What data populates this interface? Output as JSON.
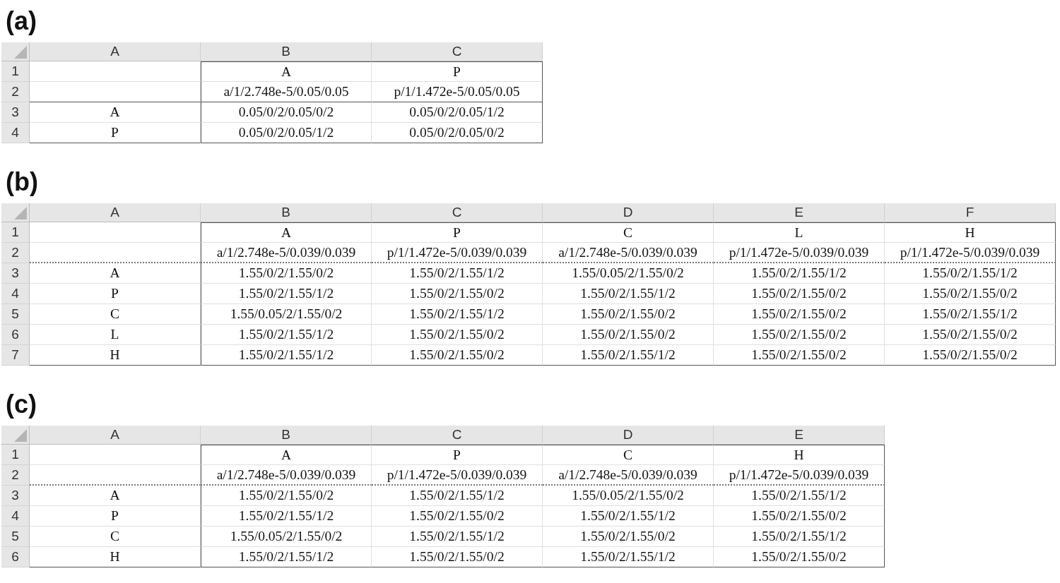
{
  "panels": [
    {
      "label": "(a)",
      "dotted_separator": false,
      "columns": [
        "A",
        "B",
        "C"
      ],
      "rows": [
        {
          "number": "1",
          "cells": [
            "",
            "A",
            "P"
          ]
        },
        {
          "number": "2",
          "cells": [
            "",
            "a/1/2.748e-5/0.05/0.05",
            "p/1/1.472e-5/0.05/0.05"
          ]
        },
        {
          "number": "3",
          "cells": [
            "A",
            "0.05/0/2/0.05/0/2",
            "0.05/0/2/0.05/1/2"
          ]
        },
        {
          "number": "4",
          "cells": [
            "P",
            "0.05/0/2/0.05/1/2",
            "0.05/0/2/0.05/0/2"
          ]
        }
      ]
    },
    {
      "label": "(b)",
      "dotted_separator": true,
      "columns": [
        "A",
        "B",
        "C",
        "D",
        "E",
        "F"
      ],
      "rows": [
        {
          "number": "1",
          "cells": [
            "",
            "A",
            "P",
            "C",
            "L",
            "H"
          ]
        },
        {
          "number": "2",
          "cells": [
            "",
            "a/1/2.748e-5/0.039/0.039",
            "p/1/1.472e-5/0.039/0.039",
            "a/1/2.748e-5/0.039/0.039",
            "p/1/1.472e-5/0.039/0.039",
            "p/1/1.472e-5/0.039/0.039"
          ]
        },
        {
          "number": "3",
          "cells": [
            "A",
            "1.55/0/2/1.55/0/2",
            "1.55/0/2/1.55/1/2",
            "1.55/0.05/2/1.55/0/2",
            "1.55/0/2/1.55/1/2",
            "1.55/0/2/1.55/1/2"
          ]
        },
        {
          "number": "4",
          "cells": [
            "P",
            "1.55/0/2/1.55/1/2",
            "1.55/0/2/1.55/0/2",
            "1.55/0/2/1.55/1/2",
            "1.55/0/2/1.55/0/2",
            "1.55/0/2/1.55/0/2"
          ]
        },
        {
          "number": "5",
          "cells": [
            "C",
            "1.55/0.05/2/1.55/0/2",
            "1.55/0/2/1.55/1/2",
            "1.55/0/2/1.55/0/2",
            "1.55/0/2/1.55/0/2",
            "1.55/0/2/1.55/1/2"
          ]
        },
        {
          "number": "6",
          "cells": [
            "L",
            "1.55/0/2/1.55/1/2",
            "1.55/0/2/1.55/0/2",
            "1.55/0/2/1.55/0/2",
            "1.55/0/2/1.55/0/2",
            "1.55/0/2/1.55/0/2"
          ]
        },
        {
          "number": "7",
          "cells": [
            "H",
            "1.55/0/2/1.55/1/2",
            "1.55/0/2/1.55/0/2",
            "1.55/0/2/1.55/1/2",
            "1.55/0/2/1.55/0/2",
            "1.55/0/2/1.55/0/2"
          ]
        }
      ]
    },
    {
      "label": "(c)",
      "dotted_separator": true,
      "columns": [
        "A",
        "B",
        "C",
        "D",
        "E"
      ],
      "rows": [
        {
          "number": "1",
          "cells": [
            "",
            "A",
            "P",
            "C",
            "H"
          ]
        },
        {
          "number": "2",
          "cells": [
            "",
            "a/1/2.748e-5/0.039/0.039",
            "p/1/1.472e-5/0.039/0.039",
            "a/1/2.748e-5/0.039/0.039",
            "p/1/1.472e-5/0.039/0.039"
          ]
        },
        {
          "number": "3",
          "cells": [
            "A",
            "1.55/0/2/1.55/0/2",
            "1.55/0/2/1.55/1/2",
            "1.55/0.05/2/1.55/0/2",
            "1.55/0/2/1.55/1/2"
          ]
        },
        {
          "number": "4",
          "cells": [
            "P",
            "1.55/0/2/1.55/1/2",
            "1.55/0/2/1.55/0/2",
            "1.55/0/2/1.55/1/2",
            "1.55/0/2/1.55/0/2"
          ]
        },
        {
          "number": "5",
          "cells": [
            "C",
            "1.55/0.05/2/1.55/0/2",
            "1.55/0/2/1.55/1/2",
            "1.55/0/2/1.55/0/2",
            "1.55/0/2/1.55/1/2"
          ]
        },
        {
          "number": "6",
          "cells": [
            "H",
            "1.55/0/2/1.55/1/2",
            "1.55/0/2/1.55/0/2",
            "1.55/0/2/1.55/1/2",
            "1.55/0/2/1.55/0/2"
          ]
        }
      ]
    }
  ]
}
